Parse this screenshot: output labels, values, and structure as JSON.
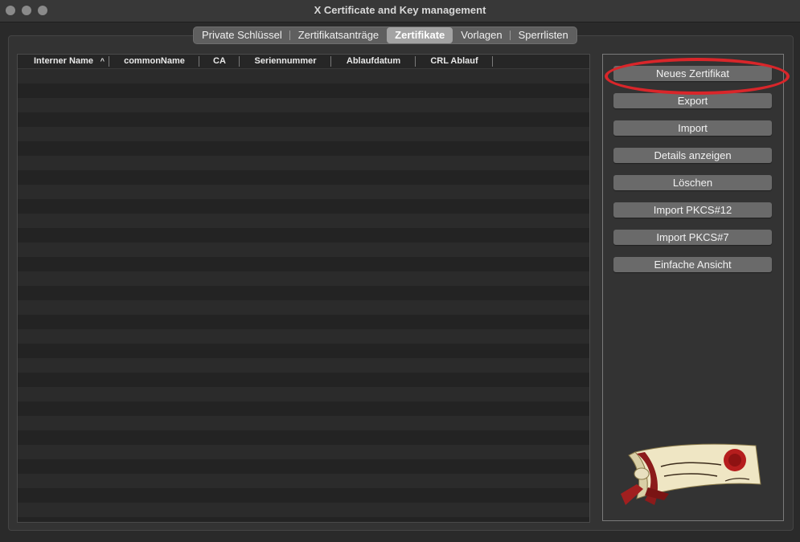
{
  "window": {
    "title": "X Certificate and Key management"
  },
  "tabs": [
    {
      "label": "Private Schlüssel",
      "active": false
    },
    {
      "label": "Zertifikatsanträge",
      "active": false
    },
    {
      "label": "Zertifikate",
      "active": true
    },
    {
      "label": "Vorlagen",
      "active": false
    },
    {
      "label": "Sperrlisten",
      "active": false
    }
  ],
  "table": {
    "columns": [
      "Interner Name",
      "commonName",
      "CA",
      "Seriennummer",
      "Ablaufdatum",
      "CRL Ablauf"
    ],
    "sort_indicator": "^",
    "rows": []
  },
  "actions": {
    "new_certificate": "Neues Zertifikat",
    "export": "Export",
    "import": "Import",
    "show_details": "Details anzeigen",
    "delete": "Löschen",
    "import_pkcs12": "Import PKCS#12",
    "import_pkcs7": "Import PKCS#7",
    "simple_view": "Einfache Ansicht"
  },
  "annotation": {
    "color": "#d9262a",
    "target": "Neues Zertifikat"
  },
  "colors": {
    "background": "#2a2a2a",
    "button": "#6a6a6a",
    "active_tab": "#a3a3a3",
    "highlight": "#d9262a"
  },
  "logo": {
    "icon": "scroll-seal-logo"
  }
}
